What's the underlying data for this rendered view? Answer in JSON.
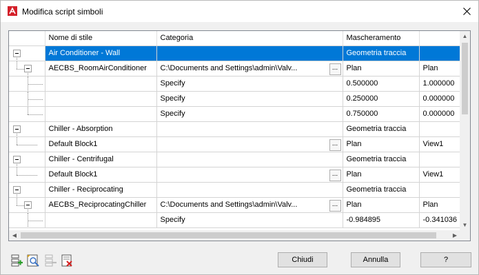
{
  "window": {
    "title": "Modifica script simboli"
  },
  "grid": {
    "columns": [
      "",
      "Nome di stile",
      "Categoria",
      "Mascheramento",
      ""
    ],
    "rows": [
      {
        "c1": "Air Conditioner - Wall",
        "c2": "",
        "c3": "Geometria traccia",
        "c4": "",
        "btn": false,
        "selected": true
      },
      {
        "c1": "AECBS_RoomAirConditioner",
        "c2": "C:\\Documents and Settings\\admin\\Valv...",
        "c3": "Plan",
        "c4": "Plan",
        "btn": true
      },
      {
        "c1": "",
        "c2": "Specify",
        "c3": "0.500000",
        "c4": "1.000000",
        "btn": false
      },
      {
        "c1": "",
        "c2": "Specify",
        "c3": "0.250000",
        "c4": "0.000000",
        "btn": false
      },
      {
        "c1": "",
        "c2": "Specify",
        "c3": "0.750000",
        "c4": "0.000000",
        "btn": false
      },
      {
        "c1": "Chiller - Absorption",
        "c2": "",
        "c3": "Geometria traccia",
        "c4": "",
        "btn": false
      },
      {
        "c1": "Default Block1",
        "c2": "",
        "c3": "Plan",
        "c4": "View1",
        "btn": true
      },
      {
        "c1": "Chiller - Centrifugal",
        "c2": "",
        "c3": "Geometria traccia",
        "c4": "",
        "btn": false
      },
      {
        "c1": "Default Block1",
        "c2": "",
        "c3": "Plan",
        "c4": "View1",
        "btn": true
      },
      {
        "c1": "Chiller - Reciprocating",
        "c2": "",
        "c3": "Geometria traccia",
        "c4": "",
        "btn": false
      },
      {
        "c1": "AECBS_ReciprocatingChiller",
        "c2": "C:\\Documents and Settings\\admin\\Valv...",
        "c3": "Plan",
        "c4": "Plan",
        "btn": true
      },
      {
        "c1": "",
        "c2": "Specify",
        "c3": "-0.984895",
        "c4": "-0.341036",
        "btn": false
      }
    ],
    "ellipsis": "..."
  },
  "buttons": {
    "close": "Chiudi",
    "cancel": "Annulla",
    "help": "?"
  },
  "colors": {
    "selection": "#0078d7",
    "accent": "#d4202a"
  }
}
